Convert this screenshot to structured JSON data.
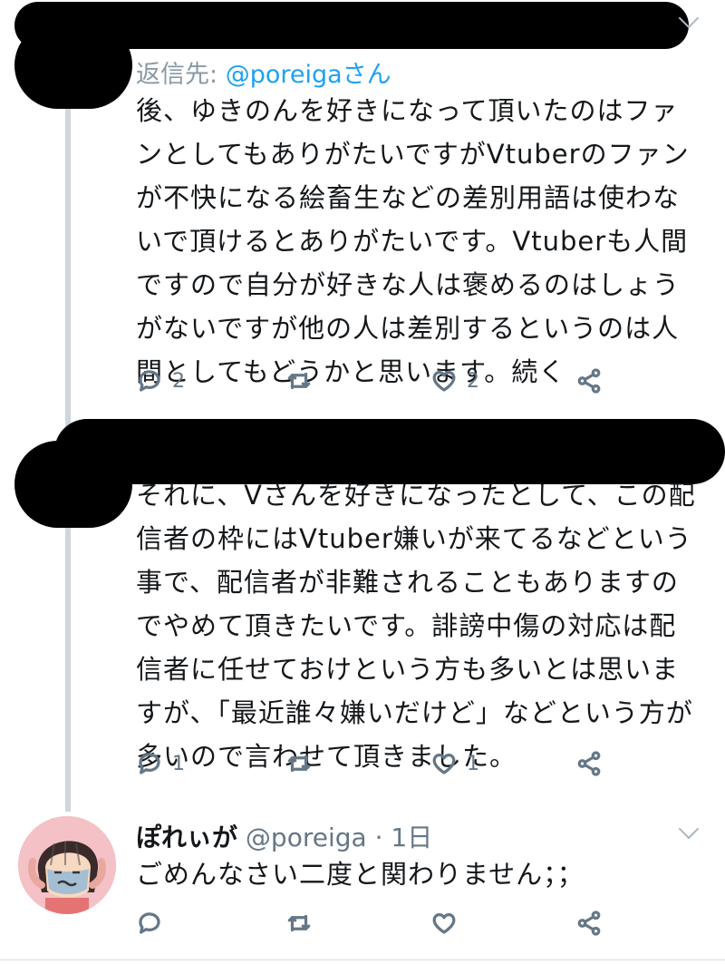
{
  "tweets": [
    {
      "reply_prefix": "返信先:",
      "reply_handle": "@poreigaさん",
      "text": "後、ゆきのんを好きになって頂いたのはファンとしてもありがたいですがVtuberのファンが不快になる絵畜生などの差別用語は使わないで頂けるとありがたいです。Vtuberも人間ですので自分が好きな人は褒めるのはしょうがないですが他の人は差別するというのは人間としてもどうかと思います。続く",
      "reply_count": "2",
      "like_count": "2"
    },
    {
      "text": "それに、Vさんを好きになったとして、この配信者の枠にはVtuber嫌いが来てるなどという事で、配信者が非難されることもありますのでやめて頂きたいです。誹謗中傷の対応は配信者に任せておけという方も多いとは思いますが、「最近誰々嫌いだけど」などという方が多いので言わせて頂きました。",
      "reply_count": "1",
      "like_count": "1"
    },
    {
      "display_name": "ぽれぃが",
      "handle": "@poreiga",
      "separator": "·",
      "time": "1日",
      "text": "ごめんなさい二度と関わりません；；"
    }
  ],
  "icons": [
    "reply-icon",
    "retweet-icon",
    "like-icon",
    "share-icon",
    "chevron-down-icon"
  ],
  "colors": {
    "link": "#1da1f2",
    "muted": "#657786",
    "thread_line": "#cfd6dc",
    "redaction": "#000000"
  }
}
